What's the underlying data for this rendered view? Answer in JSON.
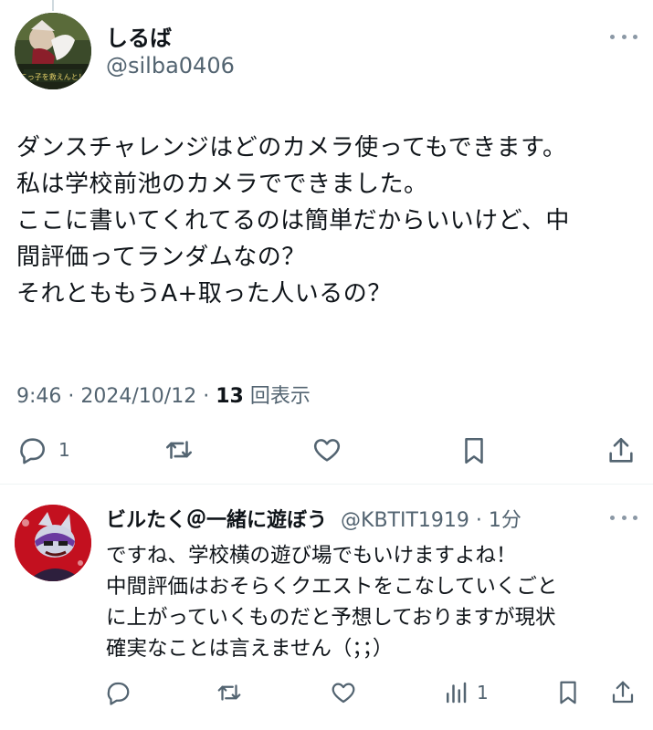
{
  "main_tweet": {
    "display_name": "しるば",
    "handle": "@silba0406",
    "avatar_caption": "こっ子を救えんと！",
    "text_lines": [
      "ダンスチャレンジはどのカメラ使ってもできます。",
      "私は学校前池のカメラでできました。",
      "ここに書いてくれてるのは簡単だからいいけど、中",
      "間評価ってランダムなの？",
      "それとももうA+取った人いるの？"
    ],
    "time": "9:46",
    "date": "2024/10/12",
    "views_count": "13",
    "views_label": "回表示",
    "reply_count": "1"
  },
  "reply_tweet": {
    "display_name": "ビルたく＠一緒に遊ぼう",
    "handle": "@KBTIT1919",
    "time_ago": "1分",
    "text_lines": [
      "ですね、学校横の遊び場でもいけますよね！",
      "中間評価はおそらくクエストをこなしていくごと",
      "に上がっていくものだと予想しておりますが現状",
      "確実なことは言えません（；；）"
    ],
    "views_count": "1"
  },
  "colors": {
    "text": "#0f1419",
    "secondary": "#536471",
    "divider": "#eff3f4"
  },
  "icons": {
    "reply": "comment-bubble-icon",
    "retweet": "retweet-arrows-icon",
    "like": "heart-icon",
    "bookmark": "bookmark-icon",
    "share": "share-upload-icon",
    "views": "bar-chart-icon",
    "more": "ellipsis-icon"
  }
}
